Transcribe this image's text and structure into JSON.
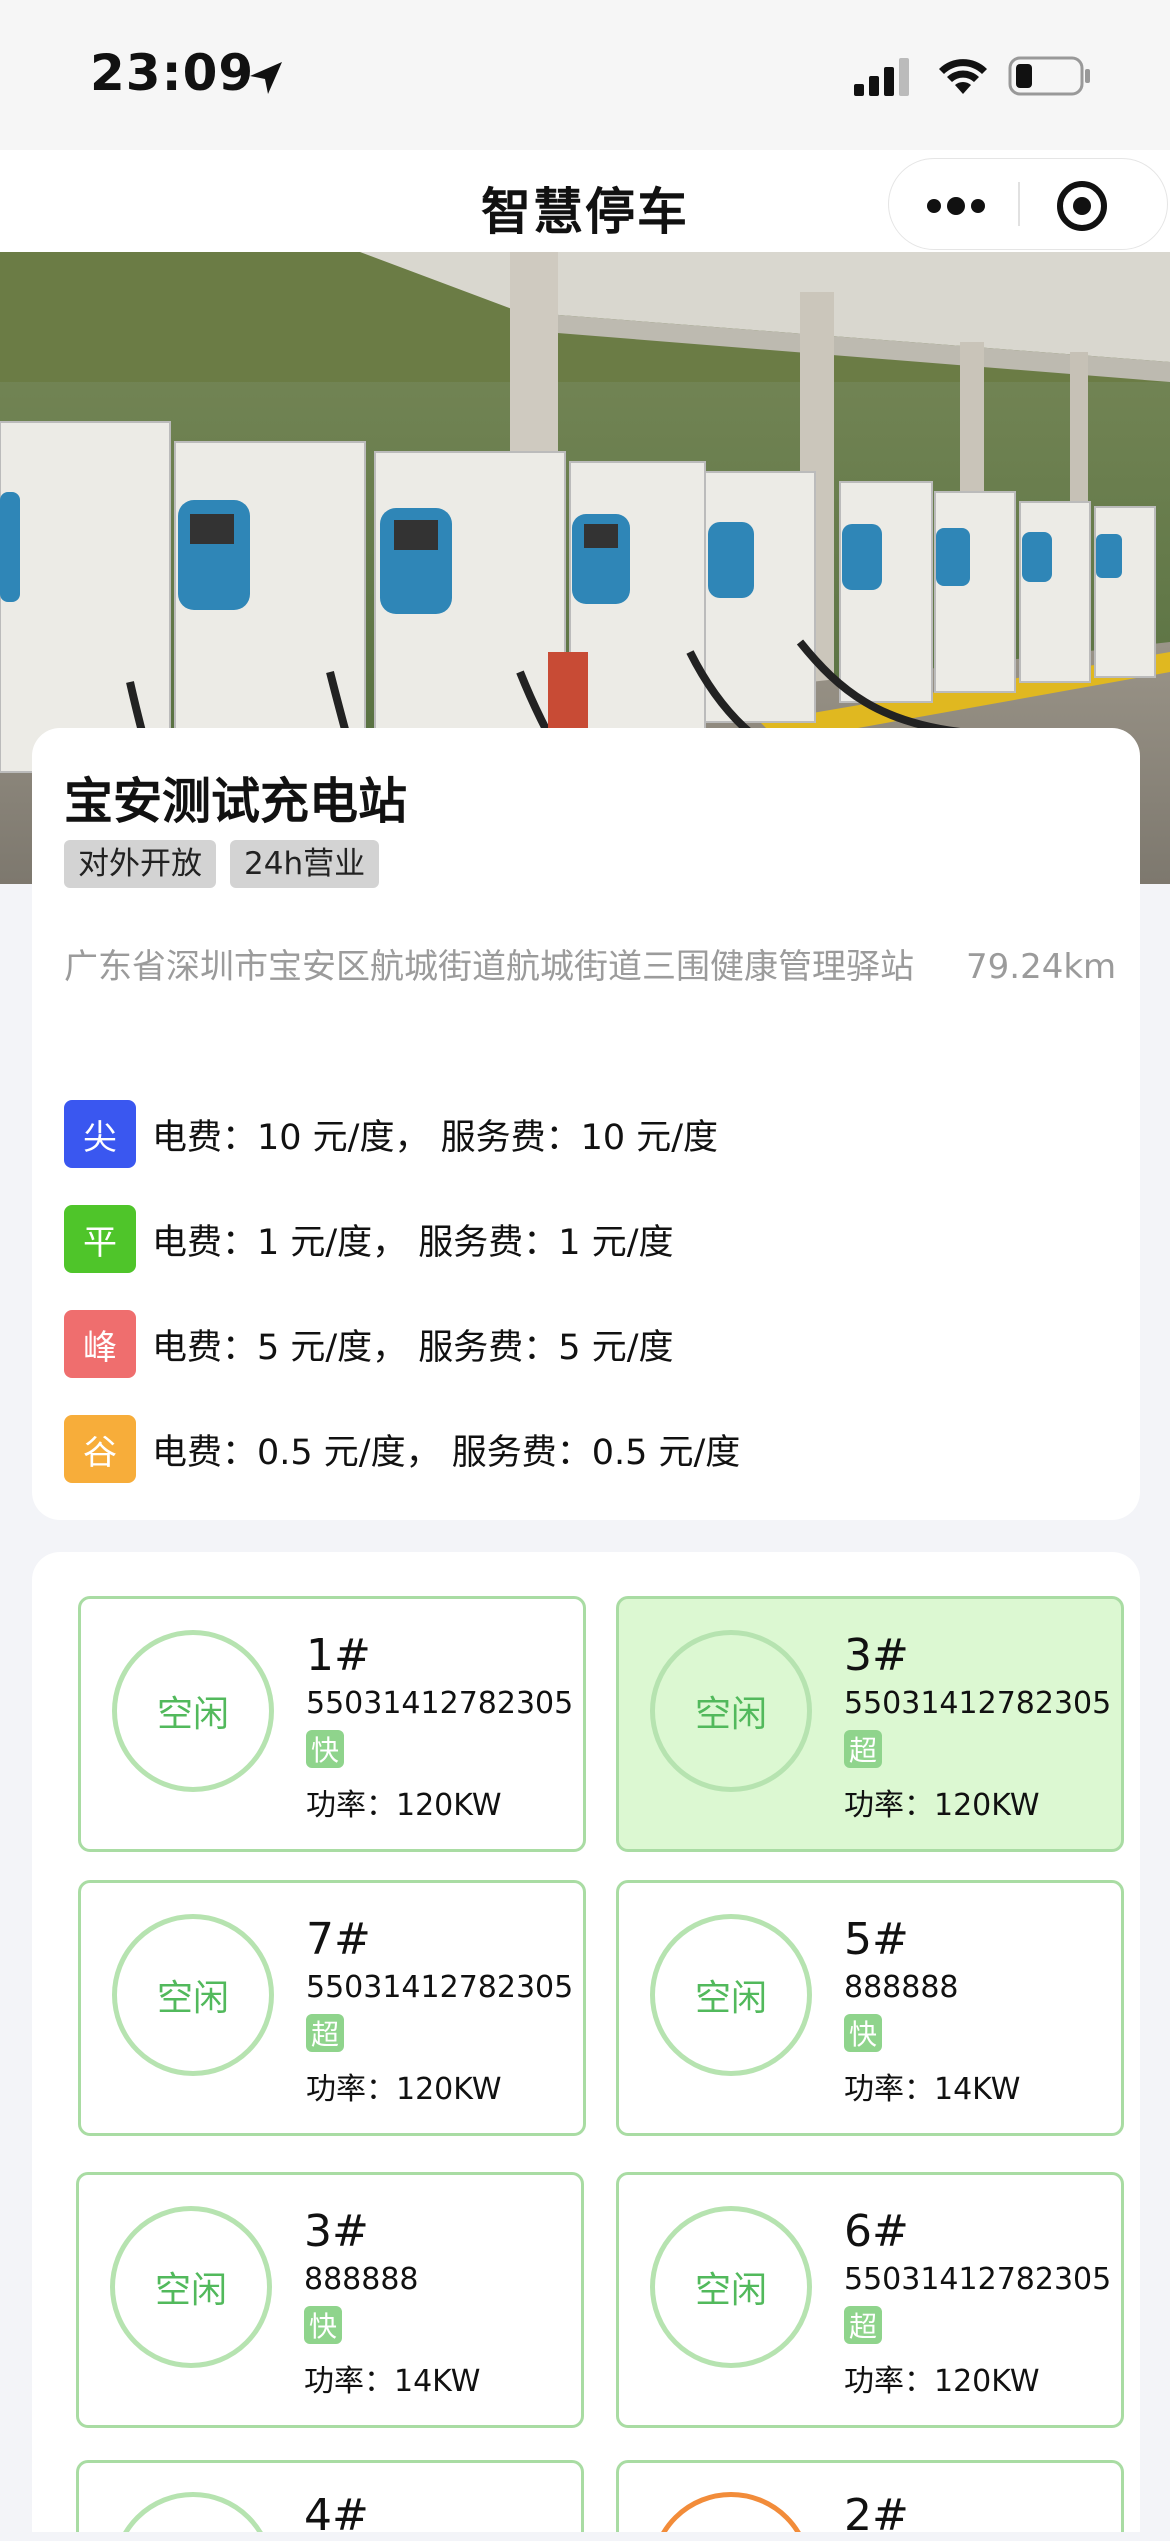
{
  "status": {
    "time": "23:09"
  },
  "nav": {
    "title": "智慧停车"
  },
  "station": {
    "name": "宝安测试充电站",
    "tags": [
      "对外开放",
      "24h营业"
    ],
    "address": "广东省深圳市宝安区航城街道航城街道三围健康管理驿站",
    "distance": "79.24km"
  },
  "prices": [
    {
      "badge": "尖",
      "color": "#3a57f0",
      "text": "电费：10 元/度， 服务费：10 元/度"
    },
    {
      "badge": "平",
      "color": "#4fc52a",
      "text": "电费：1 元/度， 服务费：1 元/度"
    },
    {
      "badge": "峰",
      "color": "#ef6e6e",
      "text": "电费：5 元/度， 服务费：5 元/度"
    },
    {
      "badge": "谷",
      "color": "#f7ad3a",
      "text": "电费：0.5 元/度， 服务费：0.5 元/度"
    }
  ],
  "chargers": [
    {
      "status": "空闲",
      "name": "1#",
      "code": "55031412782305",
      "type": "快",
      "power": "功率：120KW"
    },
    {
      "status": "空闲",
      "name": "3#",
      "code": "55031412782305",
      "type": "超",
      "power": "功率：120KW"
    },
    {
      "status": "空闲",
      "name": "7#",
      "code": "55031412782305",
      "type": "超",
      "power": "功率：120KW"
    },
    {
      "status": "空闲",
      "name": "5#",
      "code": "888888",
      "type": "快",
      "power": "功率：14KW"
    },
    {
      "status": "空闲",
      "name": "3#",
      "code": "888888",
      "type": "快",
      "power": "功率：14KW"
    },
    {
      "status": "空闲",
      "name": "6#",
      "code": "55031412782305",
      "type": "超",
      "power": "功率：120KW"
    },
    {
      "name": "4#"
    },
    {
      "name": "2#"
    }
  ],
  "colors": {
    "idle_green": "#52b95c",
    "busy_orange": "#f28c3a",
    "selected_bg": "#dcf8d2"
  },
  "icons": [
    "location-arrow-icon",
    "signal-icon",
    "wifi-icon",
    "battery-icon",
    "more-icon",
    "target-icon"
  ]
}
